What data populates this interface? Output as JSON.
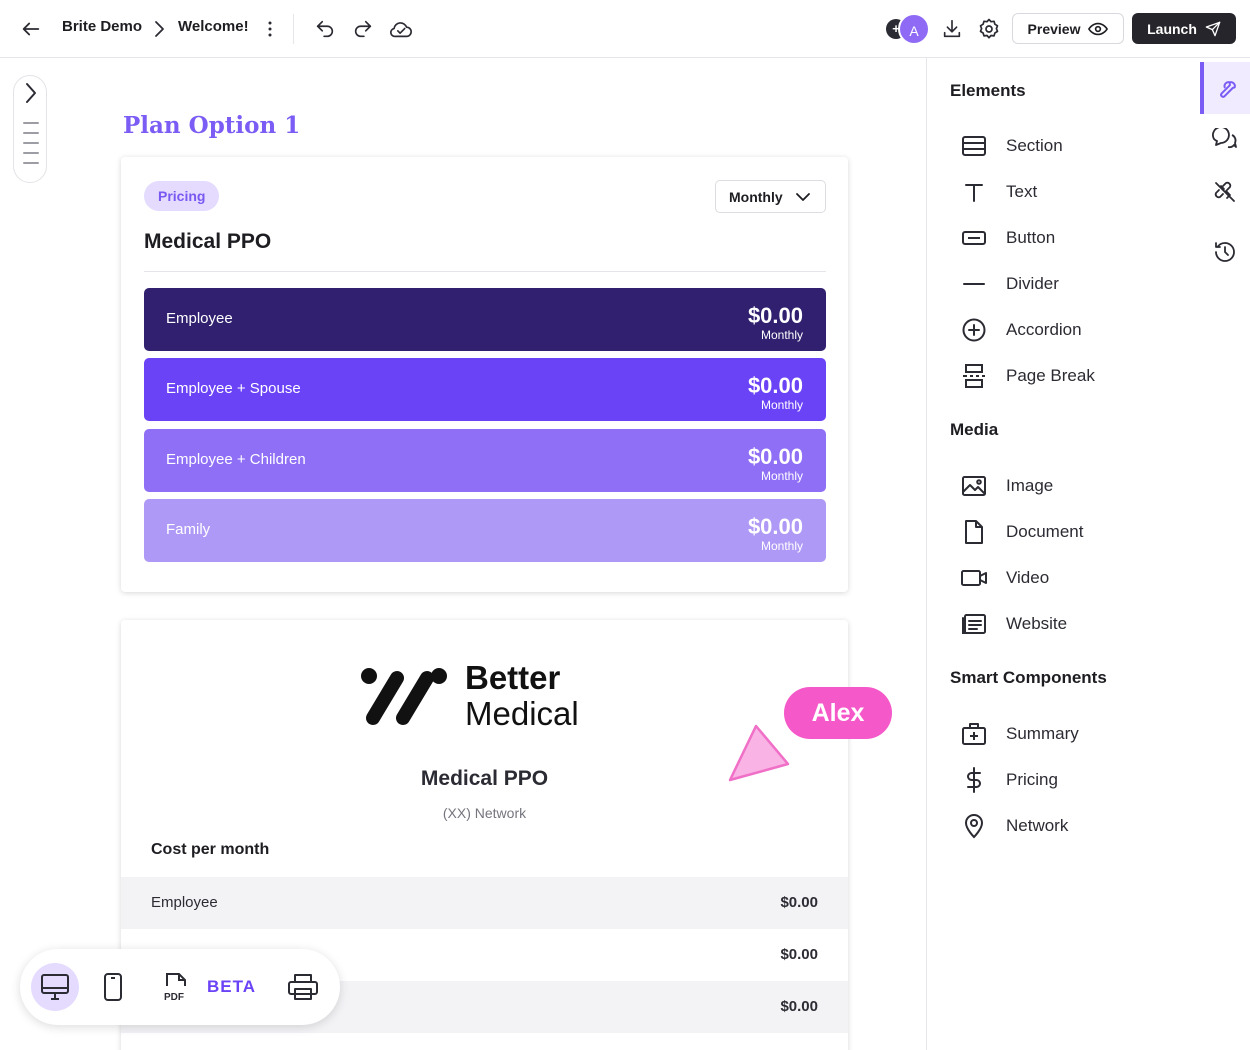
{
  "topbar": {
    "breadcrumb_project": "Brite Demo",
    "breadcrumb_page": "Welcome!",
    "avatar_initial": "A",
    "avatar_extra": "+",
    "preview_label": "Preview",
    "launch_label": "Launch"
  },
  "canvas": {
    "plan_title": "Plan Option 1",
    "pricing_card": {
      "pill": "Pricing",
      "period": "Monthly",
      "heading": "Medical PPO",
      "tiers": [
        {
          "name": "Employee",
          "price": "$0.00",
          "period": "Monthly"
        },
        {
          "name": "Employee + Spouse",
          "price": "$0.00",
          "period": "Monthly"
        },
        {
          "name": "Employee + Children",
          "price": "$0.00",
          "period": "Monthly"
        },
        {
          "name": "Family",
          "price": "$0.00",
          "period": "Monthly"
        }
      ]
    },
    "summary_card": {
      "logo_line1": "Better",
      "logo_line2": "Medical",
      "title": "Medical PPO",
      "subtitle": "(XX) Network",
      "cost_label": "Cost per month",
      "rows": [
        {
          "label": "Employee",
          "value": "$0.00"
        },
        {
          "label": "",
          "value": "$0.00"
        },
        {
          "label": "",
          "value": "$0.00"
        }
      ]
    },
    "collaborator": "Alex",
    "device_bar": {
      "beta_label": "BETA"
    }
  },
  "panel": {
    "sections": [
      {
        "heading": "Elements",
        "items": [
          "Section",
          "Text",
          "Button",
          "Divider",
          "Accordion",
          "Page Break"
        ]
      },
      {
        "heading": "Media",
        "items": [
          "Image",
          "Document",
          "Video",
          "Website"
        ]
      },
      {
        "heading": "Smart Components",
        "items": [
          "Summary",
          "Pricing",
          "Network"
        ]
      }
    ]
  },
  "colors": {
    "accent": "#7b5cf5",
    "tier_1": "#30206f",
    "tier_2": "#6b43f6",
    "tier_3": "#8f6ff5",
    "tier_4": "#af99f6",
    "collaborator": "#f558c8"
  }
}
